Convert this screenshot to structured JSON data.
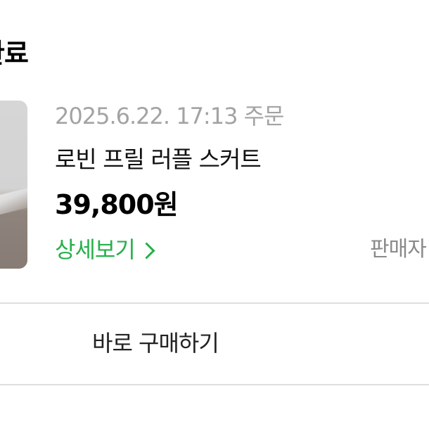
{
  "section": {
    "title": "완료"
  },
  "order": {
    "date_text": "2025.6.22. 17:13 주문",
    "product_name": "로빈 프릴 러플 스커트",
    "price": "39,800원",
    "details_link": "상세보기",
    "seller_label": "판매자"
  },
  "actions": {
    "buy_now_label": "바로 구매하기"
  },
  "colors": {
    "accent_green": "#28b04b",
    "muted_gray": "#a3a3a3",
    "divider": "#dedede"
  },
  "icons": {
    "details_chevron": "chevron-right-icon"
  }
}
